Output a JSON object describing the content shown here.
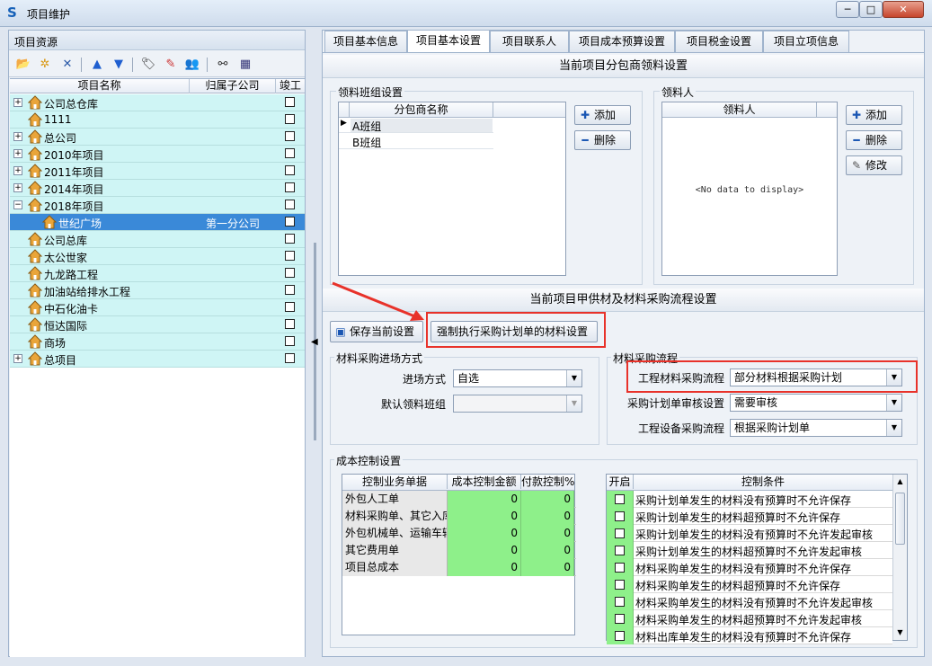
{
  "window": {
    "title": "项目维护"
  },
  "left": {
    "header": "项目资源",
    "toolbar": [
      "open-folder-icon",
      "open-multi-icon",
      "delete-icon",
      "arrow-up-icon",
      "arrow-down-icon",
      "tag-icon",
      "pencil-icon",
      "users-icon",
      "binoculars-icon",
      "grid-icon"
    ],
    "columns": [
      "项目名称",
      "归属子公司",
      "竣工"
    ],
    "items": [
      {
        "name": "公司总仓库",
        "expand": "+",
        "sub": "",
        "level": 0
      },
      {
        "name": "1111",
        "expand": "",
        "sub": "",
        "level": 0
      },
      {
        "name": "总公司",
        "expand": "+",
        "sub": "",
        "level": 0
      },
      {
        "name": "2010年项目",
        "expand": "+",
        "sub": "",
        "level": 0
      },
      {
        "name": "2011年项目",
        "expand": "+",
        "sub": "",
        "level": 0
      },
      {
        "name": "2014年项目",
        "expand": "+",
        "sub": "",
        "level": 0
      },
      {
        "name": "2018年项目",
        "expand": "-",
        "sub": "",
        "level": 0
      },
      {
        "name": "世纪广场",
        "expand": "",
        "sub": "第一分公司",
        "level": 1,
        "selected": true
      },
      {
        "name": "公司总库",
        "expand": "",
        "sub": "",
        "level": 0
      },
      {
        "name": "太公世家",
        "expand": "",
        "sub": "",
        "level": 0
      },
      {
        "name": "九龙路工程",
        "expand": "",
        "sub": "",
        "level": 0
      },
      {
        "name": "加油站给排水工程",
        "expand": "",
        "sub": "",
        "level": 0
      },
      {
        "name": "中石化油卡",
        "expand": "",
        "sub": "",
        "level": 0
      },
      {
        "name": "恒达国际",
        "expand": "",
        "sub": "",
        "level": 0
      },
      {
        "name": "商场",
        "expand": "",
        "sub": "",
        "level": 0
      },
      {
        "name": "总项目",
        "expand": "+",
        "sub": "",
        "level": 0
      }
    ]
  },
  "tabs": [
    "项目基本信息",
    "项目基本设置",
    "项目联系人",
    "项目成本预算设置",
    "项目税金设置",
    "项目立项信息"
  ],
  "subcontract": {
    "section_title": "当前项目分包商领料设置",
    "team_group": {
      "label": "领料班组设置",
      "column": "分包商名称",
      "rows": [
        "A班组",
        "B班组"
      ],
      "add": "添加",
      "delete": "删除"
    },
    "picker_group": {
      "label": "领料人",
      "column": "领料人",
      "empty": "<No data to display>",
      "add": "添加",
      "delete": "删除",
      "edit": "修改"
    }
  },
  "material": {
    "section_title": "当前项目甲供材及材料采购流程设置",
    "save_btn": "保存当前设置",
    "force_btn": "强制执行采购计划单的材料设置",
    "entry_group": {
      "label": "材料采购进场方式",
      "entry_mode_label": "进场方式",
      "entry_mode_value": "自选",
      "default_team_label": "默认领料班组",
      "default_team_value": ""
    },
    "flow_group": {
      "label": "材料采购流程",
      "eng_flow_label": "工程材料采购流程",
      "eng_flow_value": "部分材料根据采购计划",
      "audit_label": "采购计划单审核设置",
      "audit_value": "需要审核",
      "equip_flow_label": "工程设备采购流程",
      "equip_flow_value": "根据采购计划单"
    }
  },
  "cost": {
    "label": "成本控制设置",
    "columns": [
      "控制业务单据",
      "成本控制金额",
      "付款控制%"
    ],
    "rows": [
      {
        "name": "外包人工单",
        "amount": "0",
        "pay": "0"
      },
      {
        "name": "材料采购单、其它入库",
        "amount": "0",
        "pay": "0"
      },
      {
        "name": "外包机械单、运输车辆",
        "amount": "0",
        "pay": "0"
      },
      {
        "name": "其它费用单",
        "amount": "0",
        "pay": "0"
      },
      {
        "name": "项目总成本",
        "amount": "0",
        "pay": "0"
      }
    ],
    "control_columns": [
      "开启",
      "控制条件"
    ],
    "conditions": [
      "采购计划单发生的材料没有预算时不允许保存",
      "采购计划单发生的材料超预算时不允许保存",
      "采购计划单发生的材料没有预算时不允许发起审核",
      "采购计划单发生的材料超预算时不允许发起审核",
      "材料采购单发生的材料没有预算时不允许保存",
      "材料采购单发生的材料超预算时不允许保存",
      "材料采购单发生的材料没有预算时不允许发起审核",
      "材料采购单发生的材料超预算时不允许发起审核",
      "材料出库单发生的材料没有预算时不允许保存"
    ]
  },
  "colors": {
    "accent": "#3a89d8",
    "highlight": "#e8322a",
    "green_cell": "#8ef08a",
    "tree_row": "#cff5f5"
  }
}
